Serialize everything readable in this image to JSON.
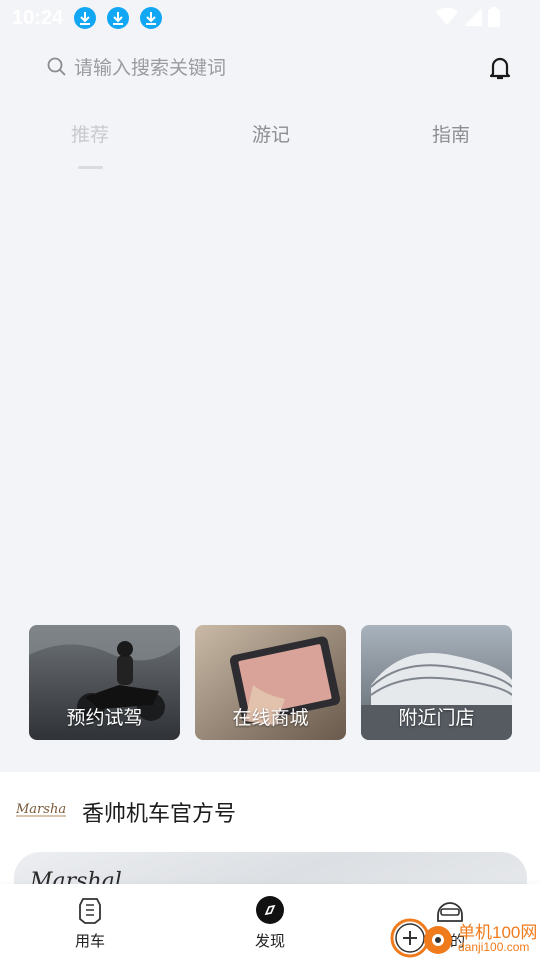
{
  "status_bar": {
    "time": "10:24"
  },
  "search": {
    "placeholder": "请输入搜索关键词"
  },
  "tabs": [
    {
      "label": "推荐",
      "active": true
    },
    {
      "label": "游记",
      "active": false
    },
    {
      "label": "指南",
      "active": false
    }
  ],
  "quick_actions": [
    {
      "label": "预约试驾"
    },
    {
      "label": "在线商城"
    },
    {
      "label": "附近门店"
    }
  ],
  "official": {
    "title": "香帅机车官方号",
    "brand": "Marshal"
  },
  "bottom_nav": [
    {
      "label": "用车",
      "icon": "motorcycle-icon"
    },
    {
      "label": "发现",
      "icon": "compass-icon"
    },
    {
      "label": "我的",
      "icon": "helmet-icon"
    }
  ],
  "watermark": {
    "text": "单机100网",
    "url": "danji100.com"
  },
  "colors": {
    "accent": "#11a7f5",
    "background": "#f3f4f7",
    "watermark": "#f07b1c"
  }
}
